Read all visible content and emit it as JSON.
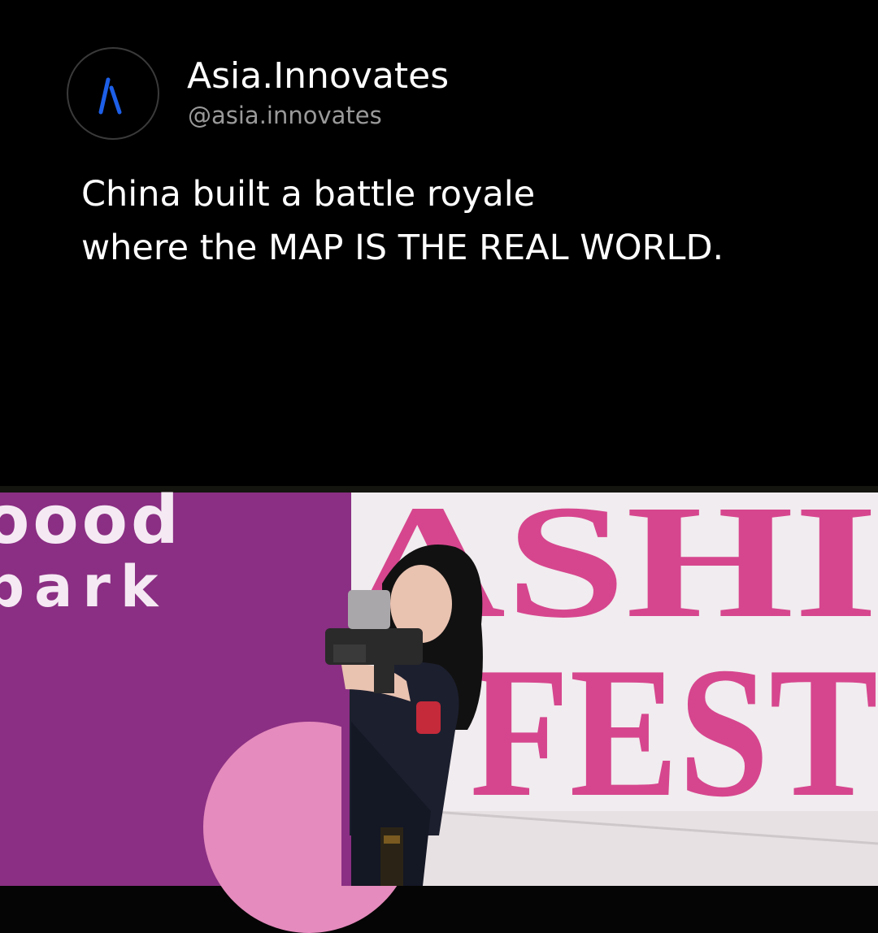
{
  "author": {
    "display_name": "Asia.Innovates",
    "handle": "@asia.innovates",
    "avatar_icon": "stylized-a-logo-icon",
    "avatar_accent": "#1d5fe8"
  },
  "post": {
    "line1": "China built a battle royale",
    "line2": "where the MAP IS THE REAL WORLD."
  },
  "media": {
    "type": "video",
    "wall_text_left_top": "oood",
    "wall_text_left_bottom": "park",
    "wall_text_right_top": "ASHI",
    "wall_text_right_bottom": "FEST",
    "colors": {
      "purple_wall": "#8a2f83",
      "pink_wall": "#f3eef2",
      "banner_text": "#d6468e",
      "background": "#000000"
    }
  }
}
